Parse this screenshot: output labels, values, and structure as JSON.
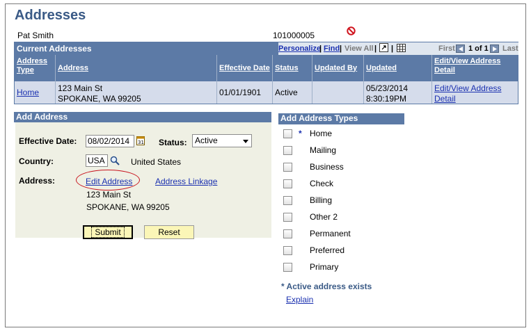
{
  "page": {
    "title": "Addresses",
    "person_name": "Pat Smith",
    "person_id": "101000005"
  },
  "current_addresses": {
    "title": "Current Addresses",
    "nav": {
      "personalize": "Personalize",
      "find": "Find",
      "view_all": "View All",
      "first": "First",
      "range": "1 of 1",
      "last": "Last"
    },
    "columns": [
      "Address Type",
      "Address",
      "Effective Date",
      "Status",
      "Updated By",
      "Updated",
      "Edit/View Address Detail"
    ],
    "rows": [
      {
        "address_type": "Home",
        "address_line1": "123 Main St",
        "address_line2": "SPOKANE, WA 99205",
        "effective_date": "01/01/1901",
        "status": "Active",
        "updated_by": "",
        "updated_date": "05/23/2014",
        "updated_time": "8:30:19PM",
        "edit_link": "Edit/View Address Detail"
      }
    ]
  },
  "add_address": {
    "title": "Add Address",
    "effective_date_label": "Effective Date:",
    "effective_date_value": "08/02/2014",
    "status_label": "Status:",
    "status_value": "Active",
    "country_label": "Country:",
    "country_code": "USA",
    "country_name": "United States",
    "address_label": "Address:",
    "edit_address_link": "Edit Address",
    "address_linkage_link": "Address Linkage",
    "address_line1": "123 Main St",
    "address_line2": "SPOKANE, WA 99205",
    "submit_label": "Submit",
    "reset_label": "Reset"
  },
  "address_types": {
    "title": "Add Address Types",
    "items": [
      {
        "label": "Home",
        "marker": "*"
      },
      {
        "label": "Mailing",
        "marker": ""
      },
      {
        "label": "Business",
        "marker": ""
      },
      {
        "label": "Check",
        "marker": ""
      },
      {
        "label": "Billing",
        "marker": ""
      },
      {
        "label": "Other 2",
        "marker": ""
      },
      {
        "label": "Permanent",
        "marker": ""
      },
      {
        "label": "Preferred",
        "marker": ""
      },
      {
        "label": "Primary",
        "marker": ""
      }
    ],
    "note": "* Active address exists",
    "explain_link": "Explain"
  },
  "colors": {
    "header_blue": "#5c7aa6",
    "row_blue": "#d5dceb",
    "link_blue": "#1b31b0",
    "title_blue": "#3a5a86",
    "button_yellow": "#fbf6b7",
    "panel_bg": "#eff0e4",
    "highlight_red": "#c8141e"
  },
  "icons": {
    "restricted": "no-entry-icon",
    "calendar": "calendar-icon",
    "lookup": "search-icon",
    "zoom": "new-window-icon",
    "download": "grid-download-icon",
    "first": "first-arrow-icon",
    "last": "last-arrow-icon"
  }
}
